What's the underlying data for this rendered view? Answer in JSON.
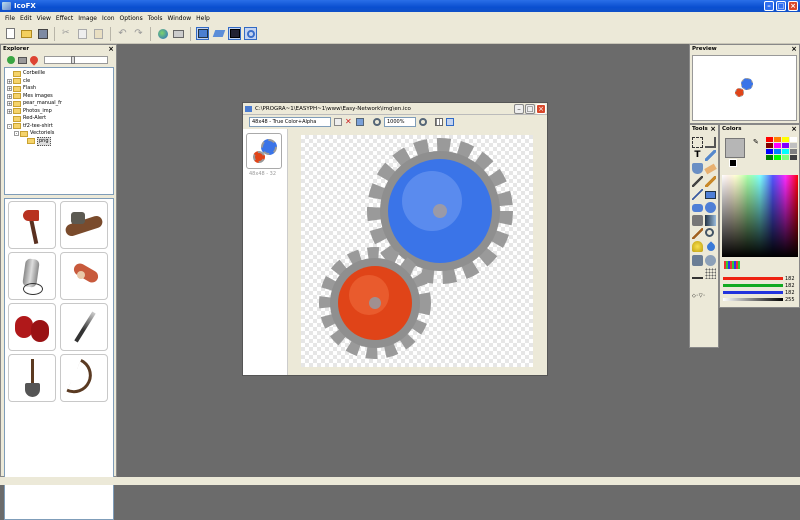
{
  "window": {
    "title": "IcoFX"
  },
  "menu": [
    "File",
    "Edit",
    "View",
    "Effect",
    "Image",
    "Icon",
    "Options",
    "Tools",
    "Window",
    "Help"
  ],
  "toolbar": [
    "new-icon",
    "open-icon",
    "save-icon",
    "cut-icon",
    "copy-icon",
    "paste-icon",
    "undo-icon",
    "redo-icon",
    "web-icon",
    "print-icon",
    "explorer-toggle-icon",
    "tools-toggle-icon",
    "colors-toggle-icon",
    "preview-toggle-icon"
  ],
  "explorer": {
    "title": "Explorer",
    "tree": [
      {
        "label": "Corbeille",
        "expander": ""
      },
      {
        "label": "cle",
        "expander": "+"
      },
      {
        "label": "Flash",
        "expander": "+"
      },
      {
        "label": "Mes images",
        "expander": "+"
      },
      {
        "label": "pear_manual_fr",
        "expander": "+"
      },
      {
        "label": "Photos_imp",
        "expander": "+"
      },
      {
        "label": "Red-Alert",
        "expander": ""
      },
      {
        "label": "tf2-tee-shirt",
        "expander": "-"
      },
      {
        "label": "Vectoriels",
        "expander": "-"
      },
      {
        "label": "png",
        "expander": ""
      }
    ],
    "thumbnails": [
      "fire-axe-icon",
      "sandvich-icon",
      "flask-icon",
      "bandage-icon",
      "boxing-gloves-icon",
      "knife-icon",
      "shovel-icon",
      "bow-icon"
    ]
  },
  "document": {
    "title": "C:\\PROGRA~1\\EASYPH~1\\www\\Easy-Network\\img\\en.ico",
    "format_value": "48x48 - True Color+Alpha",
    "zoom_value": "1000%",
    "thumb_caption": "48x48 - 32"
  },
  "preview": {
    "title": "Preview"
  },
  "tools": {
    "title": "Tools"
  },
  "colors": {
    "title": "Colors",
    "rgba_values": [
      "182",
      "182",
      "182",
      "255"
    ],
    "primary_color": "#b6b6b6",
    "secondary_color": "#000000"
  },
  "accent": {
    "blue_gear": "#3a74e8",
    "red_gear": "#e04418",
    "titlebar": "#0a4fd0"
  }
}
